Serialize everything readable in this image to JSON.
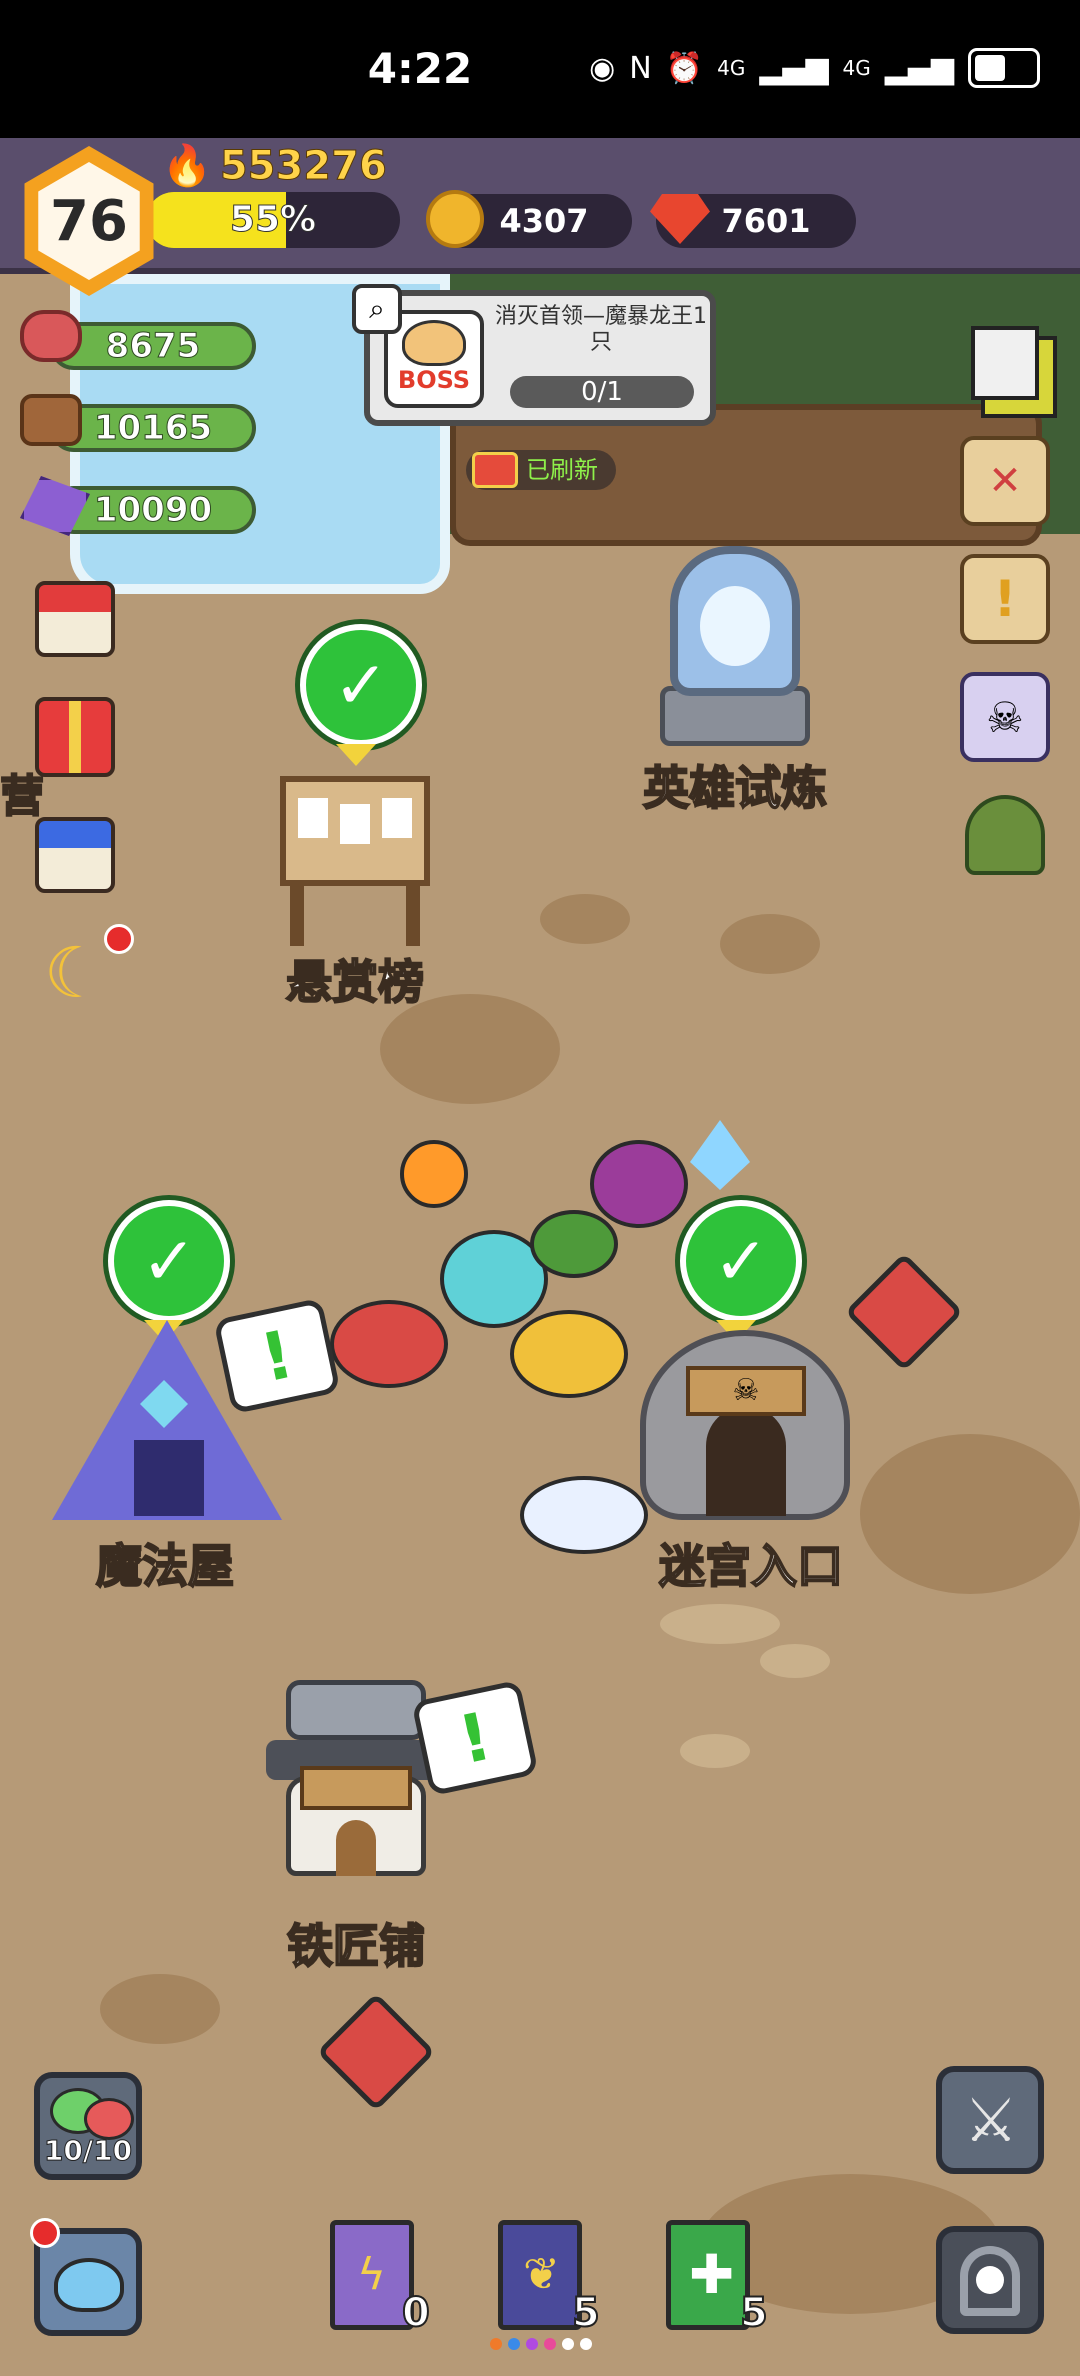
{
  "status_bar": {
    "time": "4:22",
    "network_1": "4G",
    "network_2": "4G"
  },
  "player": {
    "level": "76",
    "power": "553276",
    "exp_label": "55%",
    "exp_fraction": 0.55
  },
  "currencies": {
    "gold": "4307",
    "gems": "7601"
  },
  "resources": {
    "meat": "8675",
    "wood": "10165",
    "crystal": "10090"
  },
  "boss_quest": {
    "badge": "BOSS",
    "title": "消灭首领—魔暴龙王1只",
    "progress": "0/1"
  },
  "refresh_status": "已刷新",
  "side_label_partial": "营",
  "buildings": {
    "hero_trial": "英雄试炼",
    "bounty_board": "悬赏榜",
    "magic_house": "魔法屋",
    "maze_entrance": "迷宫入口",
    "blacksmith": "铁匠铺"
  },
  "bottom": {
    "slime_count": "10/10",
    "book_lightning_count": "0",
    "book_gold_count": "5",
    "book_green_count": "5"
  },
  "colors": {
    "top_bar": "#5a4e6c",
    "ground": "#b69a77",
    "exp_fill": "#f5e21d",
    "check_green": "#2ec23a"
  }
}
